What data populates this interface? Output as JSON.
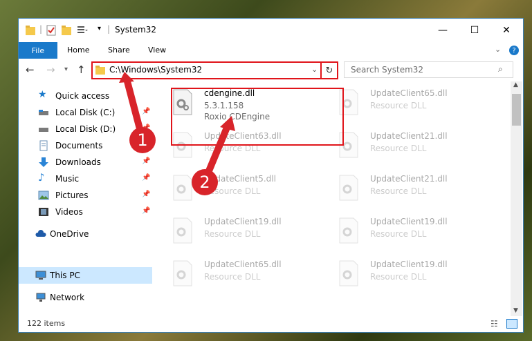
{
  "window": {
    "title": "System32"
  },
  "ribbon": {
    "file": "File",
    "home": "Home",
    "share": "Share",
    "view": "View"
  },
  "address": {
    "path": "C:\\Windows\\System32"
  },
  "search": {
    "placeholder": "Search System32"
  },
  "sidebar": {
    "items": [
      {
        "label": "Quick access",
        "icon": "star-icon"
      },
      {
        "label": "Local Disk (C:)",
        "icon": "drive-icon",
        "pinned": true
      },
      {
        "label": "Local Disk (D:)",
        "icon": "drive-icon",
        "pinned": true
      },
      {
        "label": "Documents",
        "icon": "documents-icon",
        "pinned": true
      },
      {
        "label": "Downloads",
        "icon": "download-icon",
        "pinned": true
      },
      {
        "label": "Music",
        "icon": "music-icon",
        "pinned": true
      },
      {
        "label": "Pictures",
        "icon": "pictures-icon",
        "pinned": true
      },
      {
        "label": "Videos",
        "icon": "videos-icon",
        "pinned": true
      },
      {
        "label": "OneDrive",
        "icon": "cloud-icon"
      },
      {
        "label": "This PC",
        "icon": "computer-icon",
        "selected": true
      },
      {
        "label": "Network",
        "icon": "network-icon"
      }
    ]
  },
  "files": [
    {
      "name": "cdengine.dll",
      "line1": "5.3.1.158",
      "line2": "Roxio CDEngine"
    },
    {
      "name": "UpdateClient65.dll",
      "line1": "Resource DLL"
    },
    {
      "name": "UpdateClient63.dll",
      "line1": "Resource DLL"
    },
    {
      "name": "UpdateClient21.dll",
      "line1": "Resource DLL"
    },
    {
      "name": "UpdateClient5.dll",
      "line1": "Resource DLL"
    },
    {
      "name": "UpdateClient21.dll",
      "line1": "Resource DLL"
    },
    {
      "name": "UpdateClient19.dll",
      "line1": "Resource DLL"
    },
    {
      "name": "UpdateClient19.dll",
      "line1": "Resource DLL"
    },
    {
      "name": "UpdateClient65.dll",
      "line1": "Resource DLL"
    },
    {
      "name": "UpdateClient19.dll",
      "line1": "Resource DLL"
    }
  ],
  "status": {
    "count": "122 items"
  },
  "markers": {
    "one": "1",
    "two": "2"
  },
  "colors": {
    "accent": "#1979ca",
    "highlight": "#e0141a",
    "selected": "#cce8ff"
  }
}
